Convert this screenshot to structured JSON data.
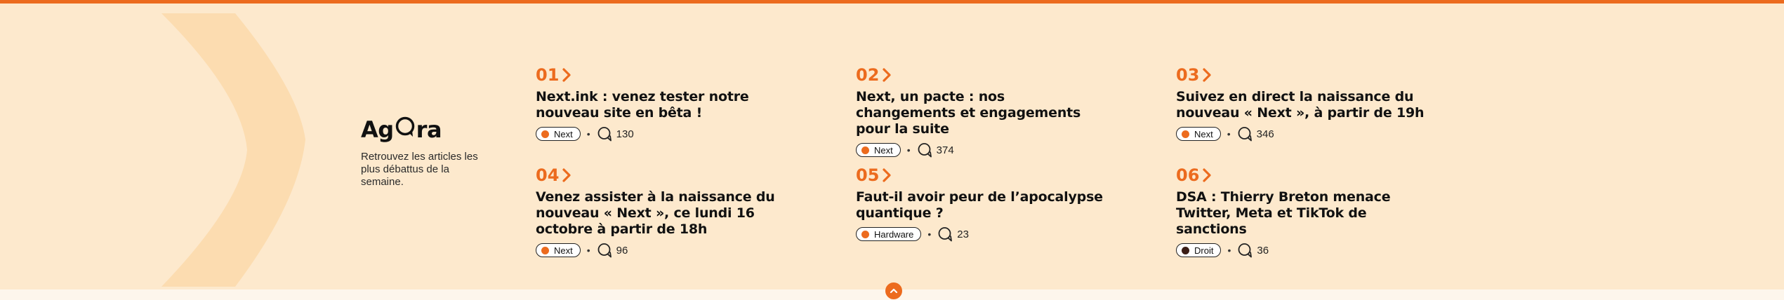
{
  "brand": {
    "logo_prefix": "Ag",
    "logo_suffix": "ra",
    "tagline": "Retrouvez les articles les plus débattus de la semaine."
  },
  "articles": [
    {
      "number": "01",
      "title": "Next.ink : venez tester notre nouveau site en bêta !",
      "tag": "Next",
      "tag_color": "#ec6b1e",
      "comments": "130"
    },
    {
      "number": "02",
      "title": "Next, un pacte : nos changements et engagements pour la suite",
      "tag": "Next",
      "tag_color": "#ec6b1e",
      "comments": "374"
    },
    {
      "number": "03",
      "title": "Suivez en direct la naissance du nouveau « Next », à partir de 19h",
      "tag": "Next",
      "tag_color": "#ec6b1e",
      "comments": "346"
    },
    {
      "number": "04",
      "title": "Venez assister à la naissance du nouveau « Next », ce lundi 16 octobre à partir de 18h",
      "tag": "Next",
      "tag_color": "#ec6b1e",
      "comments": "96"
    },
    {
      "number": "05",
      "title": "Faut-il avoir peur de l’apocalypse quantique ?",
      "tag": "Hardware",
      "tag_color": "#ec6b1e",
      "comments": "23"
    },
    {
      "number": "06",
      "title": "DSA : Thierry Breton menace Twitter, Meta et TikTok de sanctions",
      "tag": "Droit",
      "tag_color": "#3a1d16",
      "comments": "36"
    }
  ],
  "separator": "•",
  "colors": {
    "accent": "#ec6b1e",
    "band": "#fde9cd",
    "chevron": "#fcdcb0"
  },
  "icons": {
    "comment": "comment-bubble-icon",
    "collapse": "chevron-up-icon"
  }
}
